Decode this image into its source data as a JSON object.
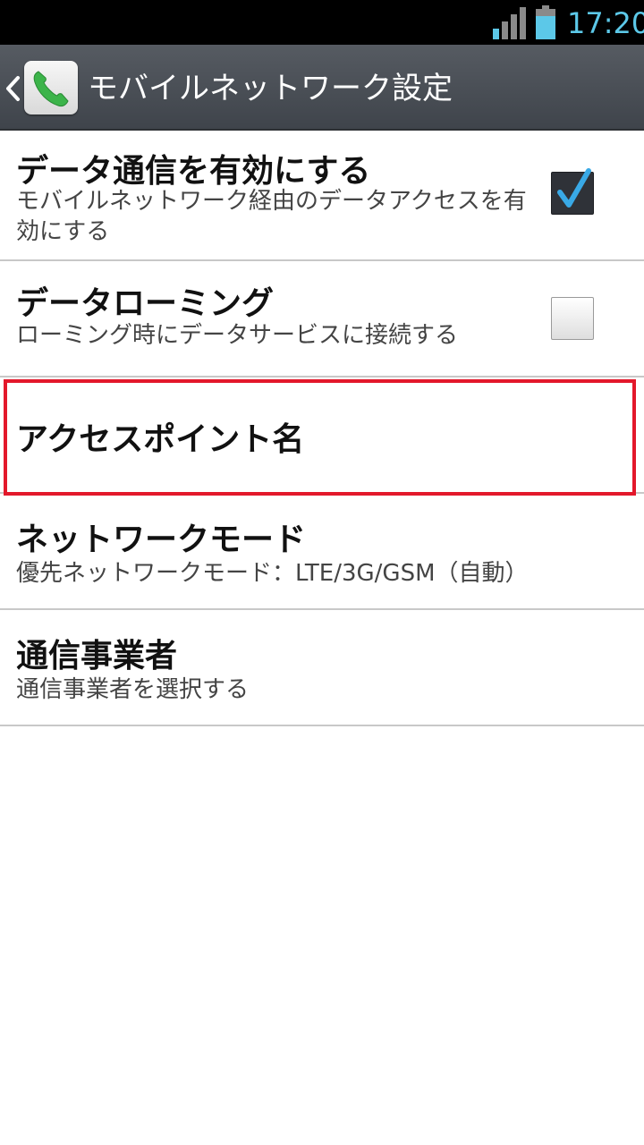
{
  "status_bar": {
    "time": "17:20",
    "icons": [
      "signal-icon",
      "battery-icon"
    ],
    "accent_color": "#5cc8e8"
  },
  "action_bar": {
    "title": "モバイルネットワーク設定",
    "back_icon": "chevron-left-icon",
    "app_icon": "phone-icon"
  },
  "settings": {
    "data_enabled": {
      "title": "データ通信を有効にする",
      "summary": "モバイルネットワーク経由のデータアクセスを有効にする",
      "checked": true
    },
    "data_roaming": {
      "title": "データローミング",
      "summary": "ローミング時にデータサービスに接続する",
      "checked": false
    },
    "access_point_names": {
      "title": "アクセスポイント名",
      "highlighted": true,
      "highlight_color": "#e3182b"
    },
    "network_mode": {
      "title": "ネットワークモード",
      "summary": "優先ネットワークモード：LTE/3G/GSM（自動）"
    },
    "operators": {
      "title": "通信事業者",
      "summary": "通信事業者を選択する"
    }
  }
}
